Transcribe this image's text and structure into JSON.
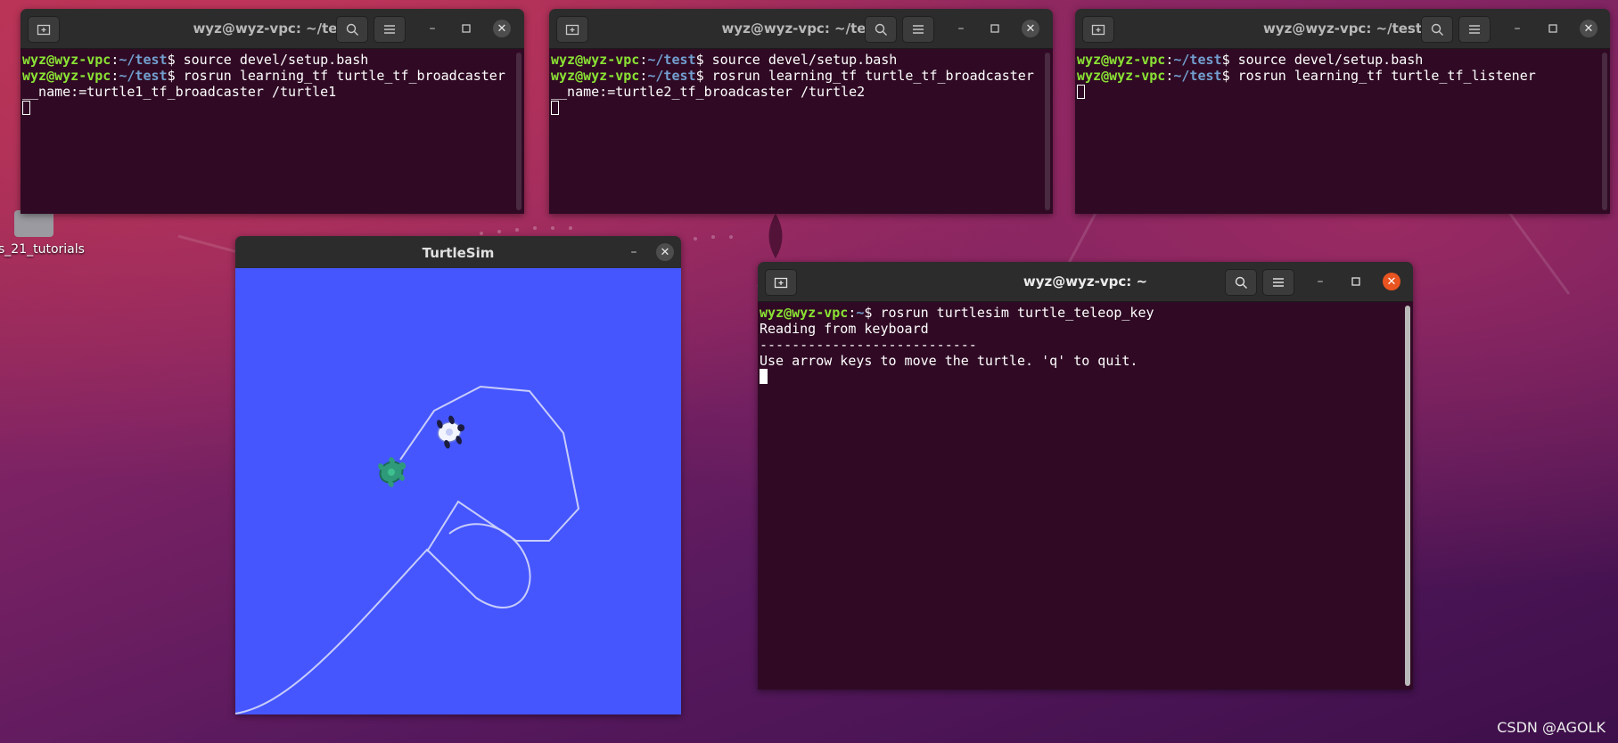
{
  "desktop": {
    "icon_label": "s_21_tutorials",
    "watermark": "CSDN @AGOLK"
  },
  "terminal1": {
    "title": "wyz@wyz-vpc: ~/test",
    "line1": {
      "user": "wyz@wyz-vpc",
      "sep": ":",
      "path": "~/test",
      "cmd": "$ source devel/setup.bash"
    },
    "line2": {
      "user": "wyz@wyz-vpc",
      "sep": ":",
      "path": "~/test",
      "cmd": "$ rosrun learning_tf turtle_tf_broadcaster"
    },
    "line3": "__name:=turtle1_tf_broadcaster /turtle1"
  },
  "terminal2": {
    "title": "wyz@wyz-vpc: ~/test",
    "line1": {
      "user": "wyz@wyz-vpc",
      "sep": ":",
      "path": "~/test",
      "cmd": "$ source devel/setup.bash"
    },
    "line2": {
      "user": "wyz@wyz-vpc",
      "sep": ":",
      "path": "~/test",
      "cmd": "$ rosrun learning_tf turtle_tf_broadcaster"
    },
    "line3": "__name:=turtle2_tf_broadcaster /turtle2"
  },
  "terminal3": {
    "title": "wyz@wyz-vpc: ~/test",
    "line1": {
      "user": "wyz@wyz-vpc",
      "sep": ":",
      "path": "~/test",
      "cmd": "$ source devel/setup.bash"
    },
    "line2": {
      "user": "wyz@wyz-vpc",
      "sep": ":",
      "path": "~/test",
      "cmd": "$ rosrun learning_tf turtle_tf_listener"
    }
  },
  "terminal4": {
    "title": "wyz@wyz-vpc: ~",
    "line1": {
      "user": "wyz@wyz-vpc",
      "sep": ":",
      "path": "~",
      "cmd": "$ rosrun turtlesim turtle_teleop_key"
    },
    "line2": "Reading from keyboard",
    "line3": "---------------------------",
    "line4": "Use arrow keys to move the turtle. 'q' to quit."
  },
  "turtlesim": {
    "title": "TurtleSim"
  },
  "icons": {
    "new_tab": "new-tab-icon",
    "search": "search-icon",
    "menu": "hamburger-menu-icon",
    "minimize": "minimize-icon",
    "maximize": "maximize-icon",
    "close": "close-icon",
    "turtle": "turtle-icon"
  },
  "colors": {
    "terminal_bg": "#300a24",
    "prompt_user": "#8ae234",
    "prompt_path": "#729fcf",
    "turtlesim_bg": "#4556ff",
    "close_active": "#e95420"
  }
}
